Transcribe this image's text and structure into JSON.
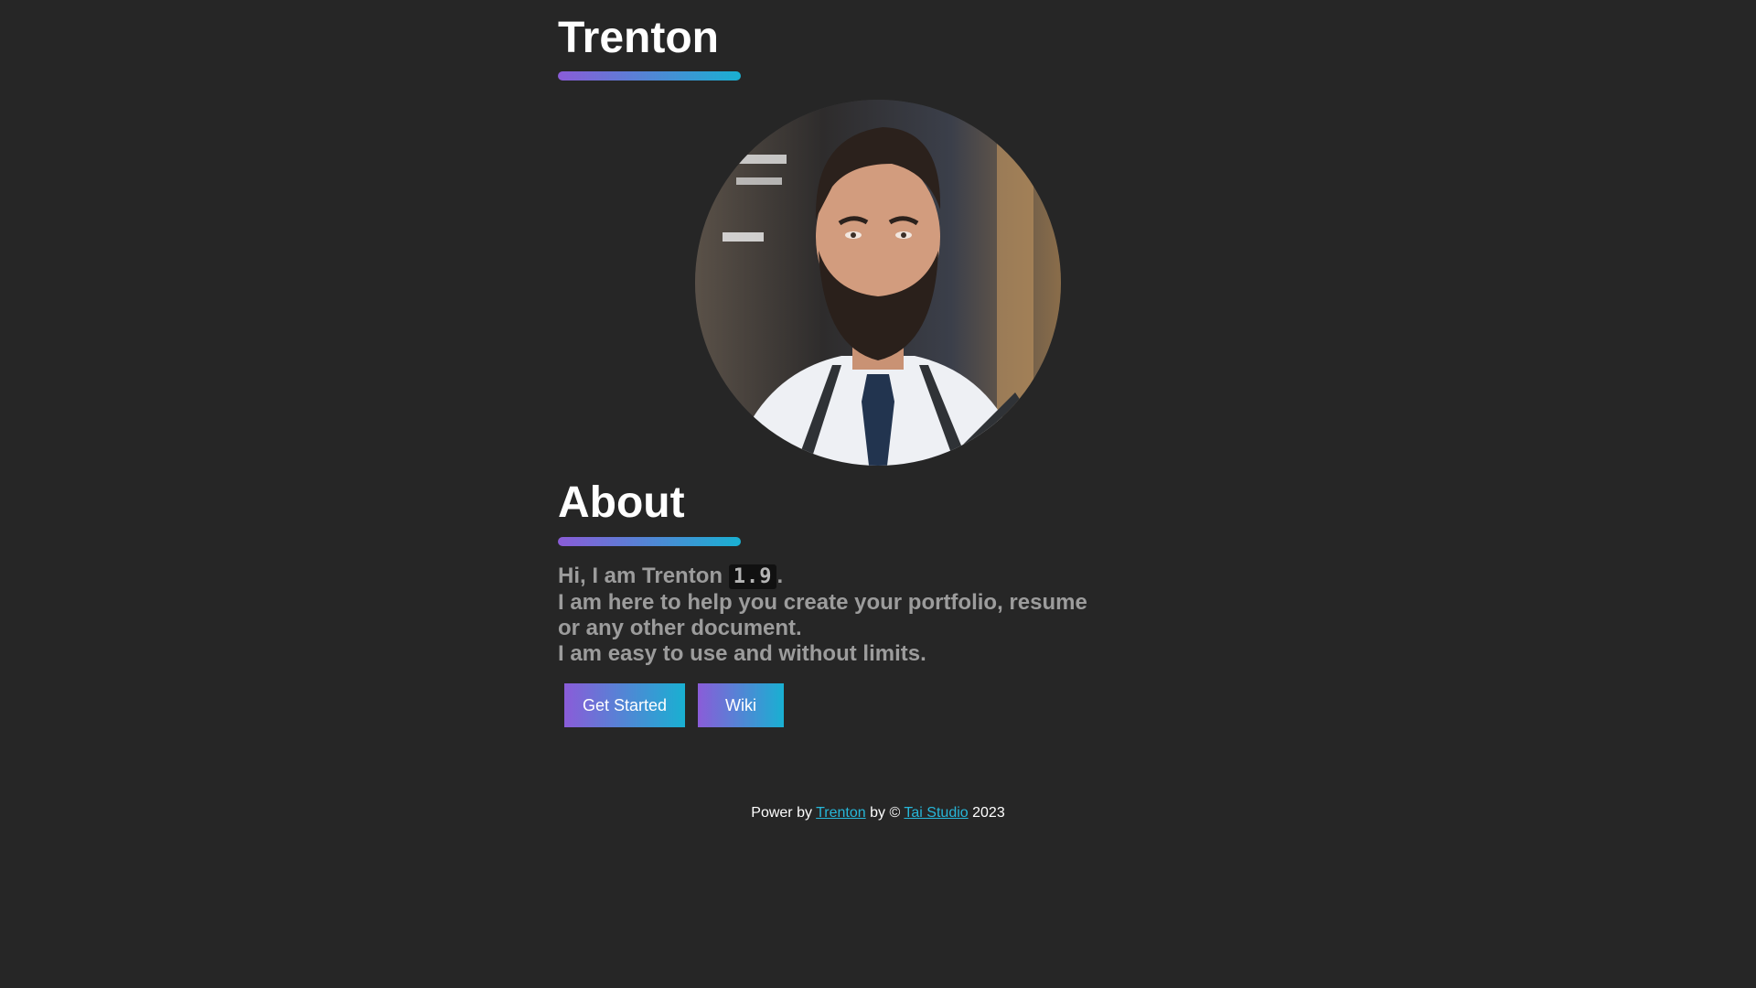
{
  "header": {
    "title": "Trenton",
    "accent_gradient": [
      "#8a5cd8",
      "#19b0d2"
    ]
  },
  "avatar": {
    "icon": "portrait-photo"
  },
  "about": {
    "title": "About",
    "intro_prefix": "Hi, I am Trenton ",
    "version": "1.9",
    "intro_suffix": ".",
    "line2": "I am here to help you create your portfolio, resume or any other document.",
    "line3": "I am easy to use and without limits."
  },
  "buttons": {
    "get_started": "Get Started",
    "wiki": "Wiki"
  },
  "footer": {
    "prefix": "Power by ",
    "link1": "Trenton",
    "middle": " by © ",
    "link2": "Tai Studio",
    "suffix": " 2023",
    "link_color": "#27b7d9"
  },
  "colors": {
    "background": "#262626",
    "text_muted": "#9c9c9c"
  }
}
